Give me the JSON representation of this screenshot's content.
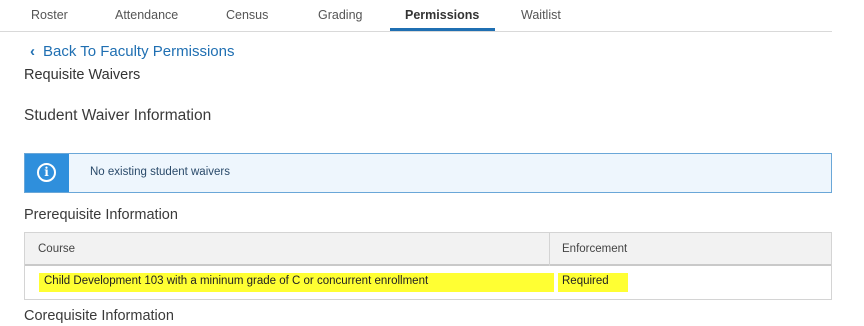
{
  "tabs": [
    {
      "label": "Roster"
    },
    {
      "label": "Attendance"
    },
    {
      "label": "Census"
    },
    {
      "label": "Grading"
    },
    {
      "label": "Permissions",
      "active": true
    },
    {
      "label": "Waitlist"
    }
  ],
  "back_link": {
    "label": "Back To Faculty Permissions",
    "icon": "chevron-left-icon"
  },
  "page_title": "Requisite Waivers",
  "waiver_section": {
    "heading": "Student Waiver Information",
    "alert": {
      "icon": "info-icon",
      "text": "No existing student waivers"
    }
  },
  "prerequisite_section": {
    "heading": "Prerequisite Information",
    "columns": [
      "Course",
      "Enforcement"
    ],
    "rows": [
      {
        "course": "Child Development 103 with a mininum grade of C or concurrent enrollment",
        "enforcement": "Required"
      }
    ]
  },
  "corequisite_section": {
    "heading": "Corequisite Information"
  },
  "colors": {
    "accent": "#1f6fb2",
    "info_blue": "#2f8fdc",
    "highlight": "#ffff33"
  }
}
